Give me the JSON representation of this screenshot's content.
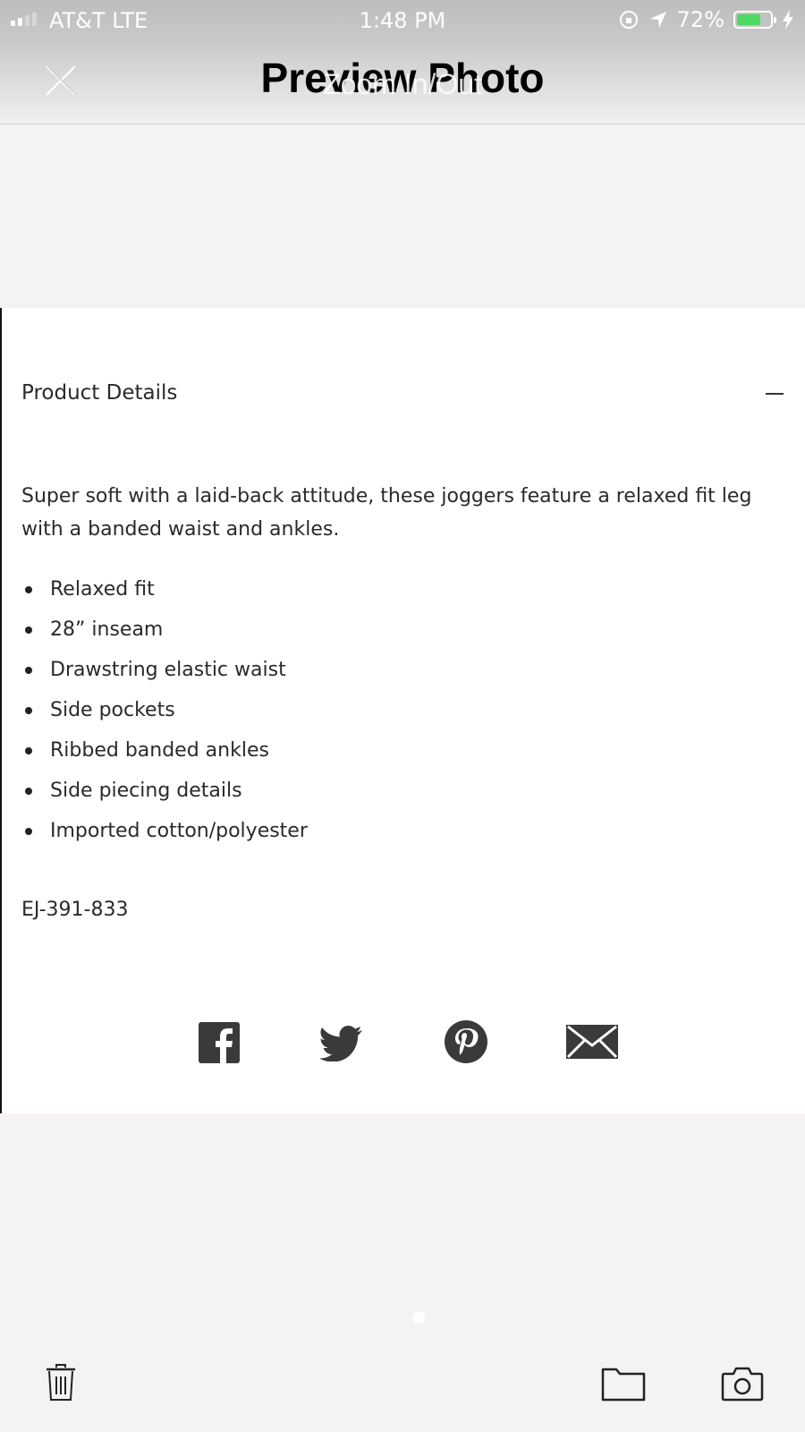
{
  "status": {
    "carrier": "AT&T  LTE",
    "time": "1:48 PM",
    "battery_text": "72%",
    "battery_level": 0.72,
    "battery_color": "#4cd964"
  },
  "nav": {
    "title": "Preview Photo",
    "overlay_hint": "Zoom In/Out",
    "close_icon": "close-icon"
  },
  "product": {
    "section_title": "Product Details",
    "collapse_icon": "minus-icon",
    "description": "Super soft with a laid-back attitude, these joggers feature a relaxed fit leg with a banded waist and ankles.",
    "features": [
      "Relaxed fit",
      "28” inseam",
      "Drawstring elastic waist",
      "Side pockets",
      "Ribbed banded ankles",
      "Side piecing details",
      "Imported cotton/polyester"
    ],
    "sku": "EJ-391-833",
    "share_icons": [
      "facebook-icon",
      "twitter-icon",
      "pinterest-icon",
      "email-icon"
    ]
  },
  "pager": {
    "current": 1
  },
  "toolbar": {
    "icons": [
      "trash-icon",
      "folder-icon",
      "camera-icon"
    ]
  }
}
